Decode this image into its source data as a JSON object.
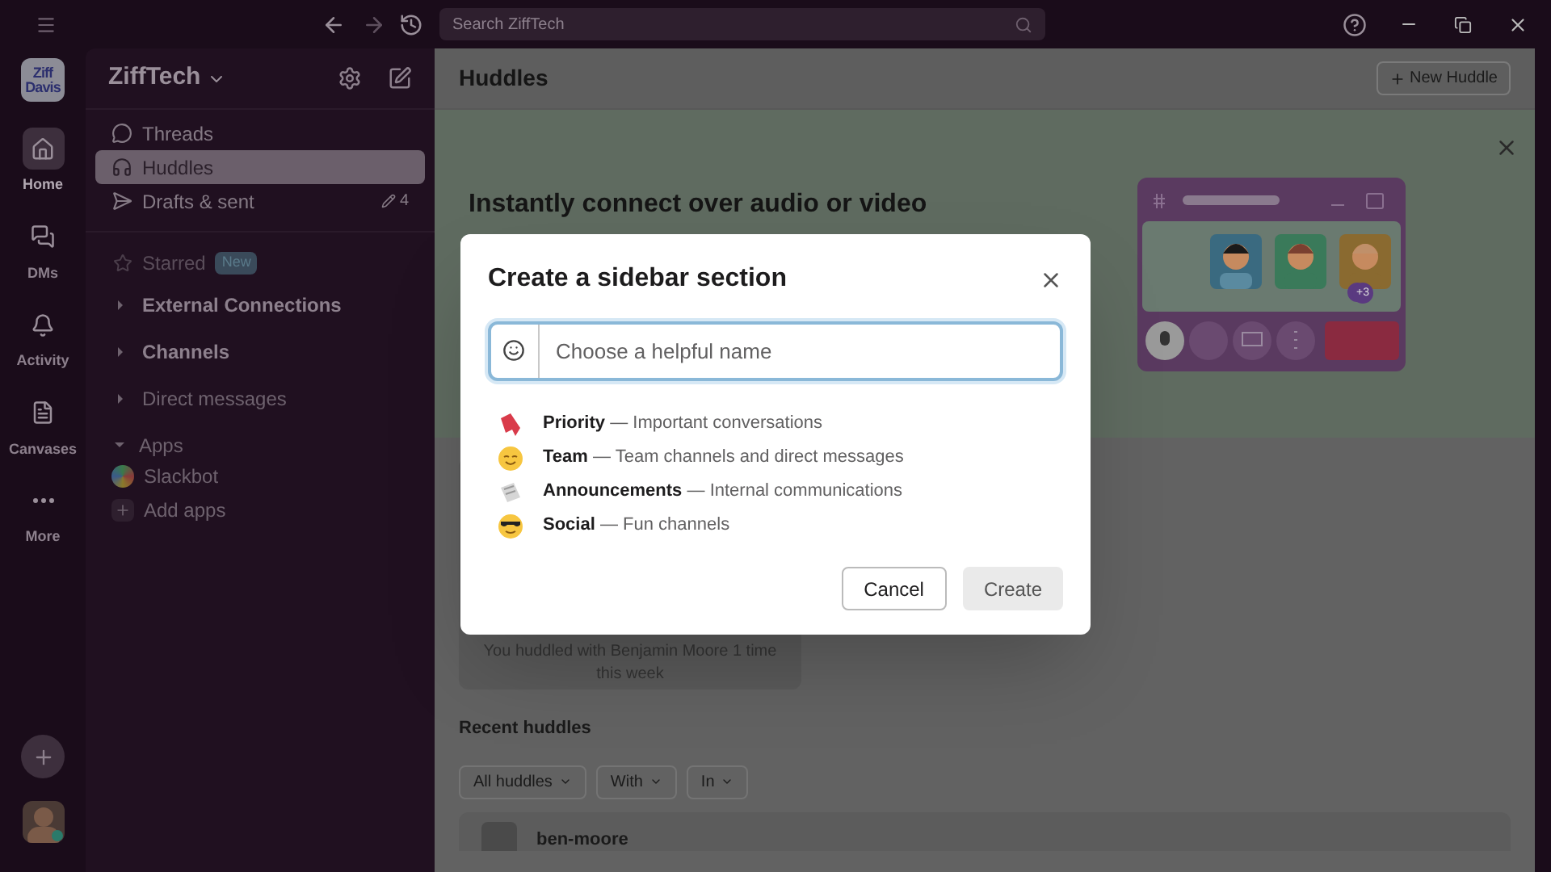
{
  "titlebar": {
    "search_placeholder": "Search ZiffTech"
  },
  "rail": {
    "logo": [
      "Ziff",
      "Davis"
    ],
    "items": [
      {
        "label": "Home",
        "kind": "home",
        "selected": true
      },
      {
        "label": "DMs",
        "kind": "dms",
        "selected": false
      },
      {
        "label": "Activity",
        "kind": "activity",
        "selected": false
      },
      {
        "label": "Canvases",
        "kind": "canvases",
        "selected": false
      },
      {
        "label": "More",
        "kind": "more",
        "selected": false
      }
    ]
  },
  "workspace": {
    "name": "ZiffTech"
  },
  "sidebar": {
    "items": [
      {
        "label": "Threads",
        "kind": "threads",
        "selected": false
      },
      {
        "label": "Huddles",
        "kind": "huddles",
        "selected": true
      },
      {
        "label": "Drafts & sent",
        "kind": "drafts",
        "selected": false,
        "count": "4"
      }
    ],
    "starred": {
      "label": "Starred",
      "badge": "New"
    },
    "sections": [
      {
        "label": "External Connections",
        "unread": true,
        "expanded": false
      },
      {
        "label": "Channels",
        "unread": true,
        "expanded": false
      },
      {
        "label": "Direct messages",
        "unread": false,
        "expanded": false
      },
      {
        "label": "Apps",
        "unread": false,
        "expanded": true,
        "children": [
          {
            "label": "Slackbot",
            "kind": "app"
          },
          {
            "label": "Add apps",
            "kind": "add"
          }
        ]
      }
    ]
  },
  "main": {
    "title": "Huddles",
    "new_button": "New Huddle",
    "hero": {
      "heading": "Instantly connect over audio or video",
      "badge": "+3"
    },
    "stat": "You huddled with Benjamin Moore 1 time this week",
    "recent_title": "Recent huddles",
    "filters": [
      "All huddles",
      "With",
      "In"
    ],
    "row": "ben-moore"
  },
  "modal": {
    "title": "Create a sidebar section",
    "placeholder": "Choose a helpful name",
    "suggestions": [
      {
        "kind": "bookmark",
        "name": "Priority",
        "description": "Important conversations"
      },
      {
        "kind": "smile",
        "name": "Team",
        "description": "Team channels and direct messages"
      },
      {
        "kind": "scroll",
        "name": "Announcements",
        "description": "Internal communications"
      },
      {
        "kind": "sunglasses",
        "name": "Social",
        "description": "Fun channels"
      }
    ],
    "separator": "—",
    "cancel": "Cancel",
    "create": {
      "label": "Create",
      "disabled": true
    }
  }
}
